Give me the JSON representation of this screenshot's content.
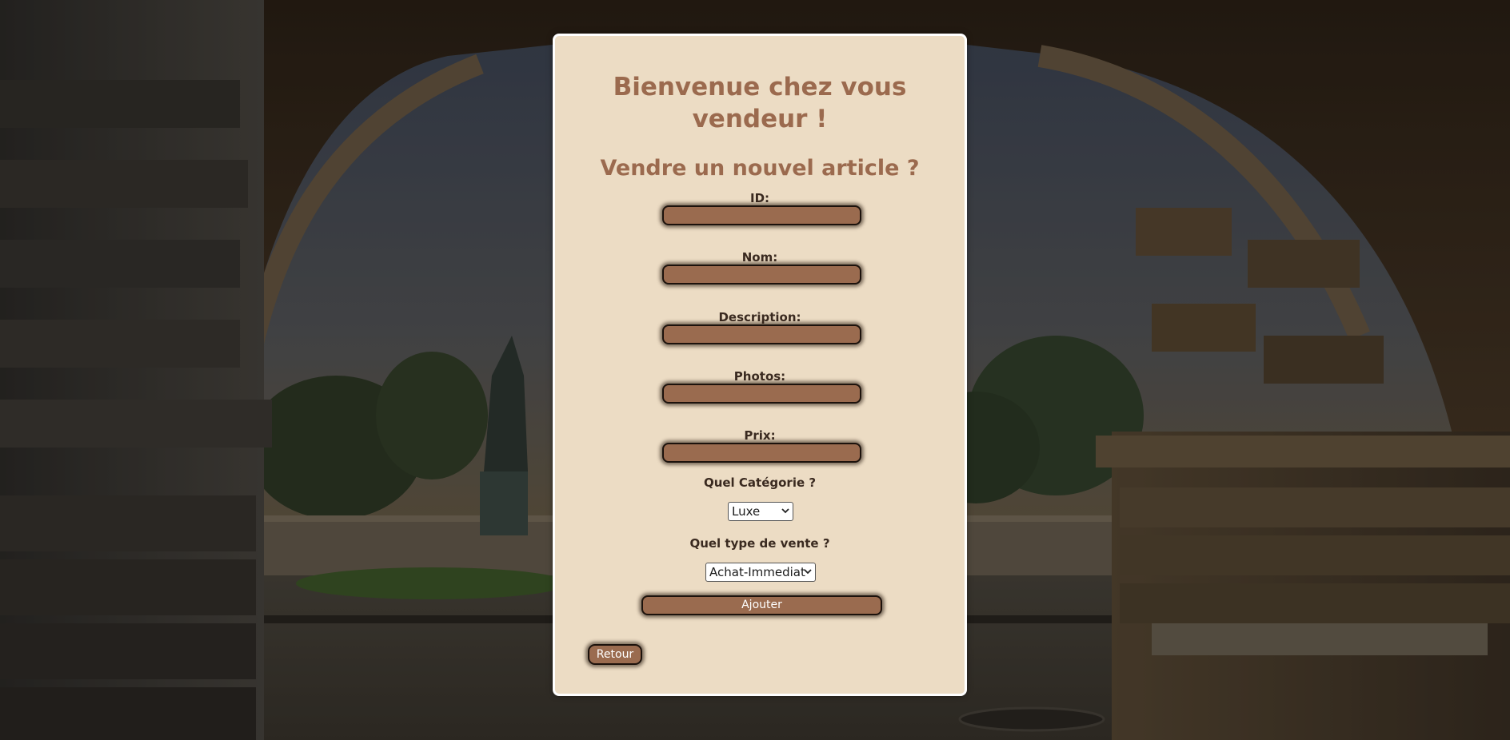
{
  "page": {
    "heading_line1": "Bienvenue chez vous",
    "heading_line2": "vendeur !",
    "subheading": "Vendre un nouvel article ?"
  },
  "form": {
    "fields": [
      {
        "label": "ID:",
        "value": ""
      },
      {
        "label": "Nom:",
        "value": ""
      },
      {
        "label": "Description:",
        "value": ""
      },
      {
        "label": "Photos:",
        "value": ""
      },
      {
        "label": "Prix:",
        "value": ""
      }
    ],
    "category": {
      "label": "Quel Catégorie ?",
      "selected": "Luxe"
    },
    "sale_type": {
      "label": "Quel type de vente ?",
      "selected": "Achat-Immediat"
    },
    "submit_label": "Ajouter"
  },
  "nav": {
    "back_label": "Retour"
  },
  "colors": {
    "card_background": "#ecdcc4",
    "heading": "#9b6a4e",
    "input_fill": "#9a6b4f",
    "label_text": "#3a2a20"
  }
}
